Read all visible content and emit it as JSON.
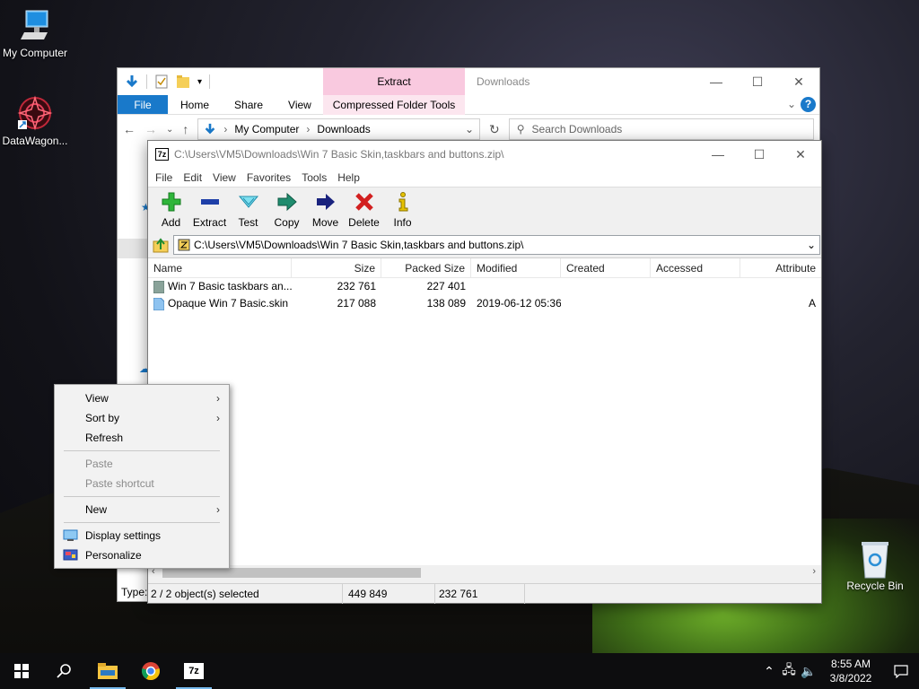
{
  "desktop": {
    "icons": [
      {
        "label": "My Computer"
      },
      {
        "label": "DataWagon..."
      },
      {
        "label": "Recycle Bin"
      }
    ]
  },
  "explorer": {
    "title": "Downloads",
    "context_tab": "Extract",
    "ribbon_tabs": [
      "File",
      "Home",
      "Share",
      "View"
    ],
    "context_group": "Compressed Folder Tools",
    "breadcrumb": [
      "My Computer",
      "Downloads"
    ],
    "search_placeholder": "Search Downloads",
    "status_fragment": "Type:"
  },
  "sevenzip": {
    "title": "C:\\Users\\VM5\\Downloads\\Win 7 Basic Skin,taskbars and buttons.zip\\",
    "menu": [
      "File",
      "Edit",
      "View",
      "Favorites",
      "Tools",
      "Help"
    ],
    "toolbar": [
      {
        "label": "Add",
        "icon": "add-icon",
        "color": "#2fb53a"
      },
      {
        "label": "Extract",
        "icon": "extract-icon",
        "color": "#1e3fa8"
      },
      {
        "label": "Test",
        "icon": "test-icon",
        "color": "#2aa7c9"
      },
      {
        "label": "Copy",
        "icon": "copy-icon",
        "color": "#1f8c6e"
      },
      {
        "label": "Move",
        "icon": "move-icon",
        "color": "#1a237e"
      },
      {
        "label": "Delete",
        "icon": "delete-icon",
        "color": "#d21f1f"
      },
      {
        "label": "Info",
        "icon": "info-icon",
        "color": "#e6c200"
      }
    ],
    "path": "C:\\Users\\VM5\\Downloads\\Win 7 Basic Skin,taskbars and buttons.zip\\",
    "columns": [
      "Name",
      "Size",
      "Packed Size",
      "Modified",
      "Created",
      "Accessed",
      "Attribute"
    ],
    "rows": [
      {
        "name": "Win 7 Basic taskbars an...",
        "size": "232 761",
        "packed": "227 401",
        "modified": "",
        "created": "",
        "accessed": "",
        "attr": "",
        "type": "folder"
      },
      {
        "name": "Opaque Win 7 Basic.skin",
        "size": "217 088",
        "packed": "138 089",
        "modified": "2019-06-12 05:36",
        "created": "",
        "accessed": "",
        "attr": "A",
        "type": "file"
      }
    ],
    "status": {
      "selected": "2 / 2 object(s) selected",
      "size": "449 849",
      "packed": "232 761"
    }
  },
  "context_menu": {
    "items": [
      {
        "label": "View",
        "submenu": true
      },
      {
        "label": "Sort by",
        "submenu": true
      },
      {
        "label": "Refresh"
      },
      {
        "label": "Paste",
        "disabled": true
      },
      {
        "label": "Paste shortcut",
        "disabled": true
      },
      {
        "label": "New",
        "submenu": true
      },
      {
        "label": "Display settings",
        "icon": "display-icon"
      },
      {
        "label": "Personalize",
        "icon": "personalize-icon"
      }
    ]
  },
  "taskbar": {
    "clock_time": "8:55 AM",
    "clock_date": "3/8/2022",
    "accent": "#76b9ed"
  }
}
